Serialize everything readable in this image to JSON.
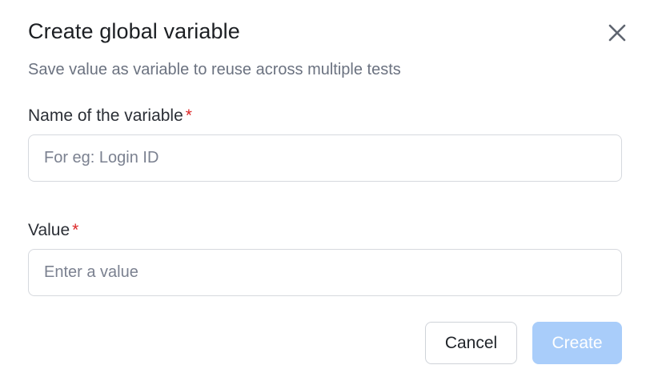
{
  "dialog": {
    "title": "Create global variable",
    "subtitle": "Save value as variable to reuse across multiple tests",
    "close_icon": "close-icon"
  },
  "fields": {
    "name": {
      "label": "Name of the variable",
      "required_marker": "*",
      "placeholder": "For eg: Login ID",
      "value": ""
    },
    "value": {
      "label": "Value",
      "required_marker": "*",
      "placeholder": "Enter a value",
      "value": ""
    }
  },
  "actions": {
    "cancel_label": "Cancel",
    "create_label": "Create",
    "create_disabled": true
  },
  "colors": {
    "required": "#dc2626",
    "primary_disabled": "#a9cdfa",
    "subtitle": "#6b7280",
    "border": "#d6d9de"
  }
}
